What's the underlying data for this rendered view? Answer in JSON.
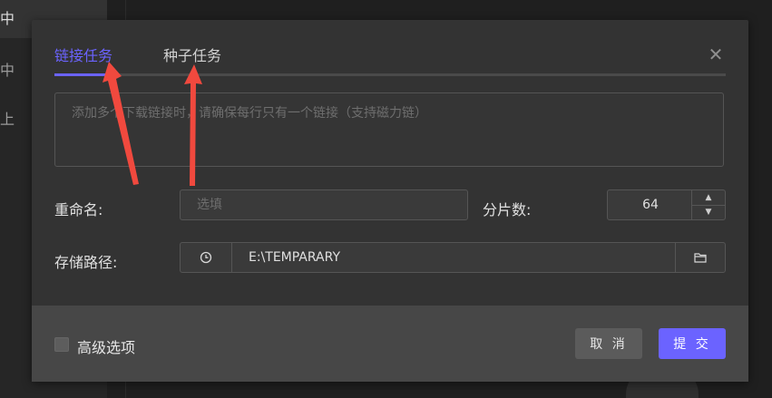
{
  "background": {
    "sidebar_items": [
      "中",
      "中",
      "上"
    ]
  },
  "dialog": {
    "tabs": [
      {
        "label": "链接任务",
        "active": true
      },
      {
        "label": "种子任务",
        "active": false
      }
    ],
    "close_icon": "close-icon",
    "url_textarea": {
      "placeholder": "添加多个下载链接时，请确保每行只有一个链接（支持磁力链）",
      "value": ""
    },
    "rename": {
      "label": "重命名:",
      "placeholder": "选填",
      "value": ""
    },
    "slices": {
      "label": "分片数:",
      "value": "64"
    },
    "path": {
      "label": "存储路径:",
      "value": "E:\\TEMPARARY",
      "history_icon": "clock-icon",
      "folder_icon": "folder-icon"
    },
    "footer": {
      "advanced_label": "高级选项",
      "advanced_checked": false,
      "cancel_label": "取 消",
      "submit_label": "提 交"
    }
  },
  "colors": {
    "accent": "#6b63ff",
    "annotation_arrow": "#f0493e",
    "dialog_bg": "#333333",
    "footer_bg": "#474747"
  }
}
